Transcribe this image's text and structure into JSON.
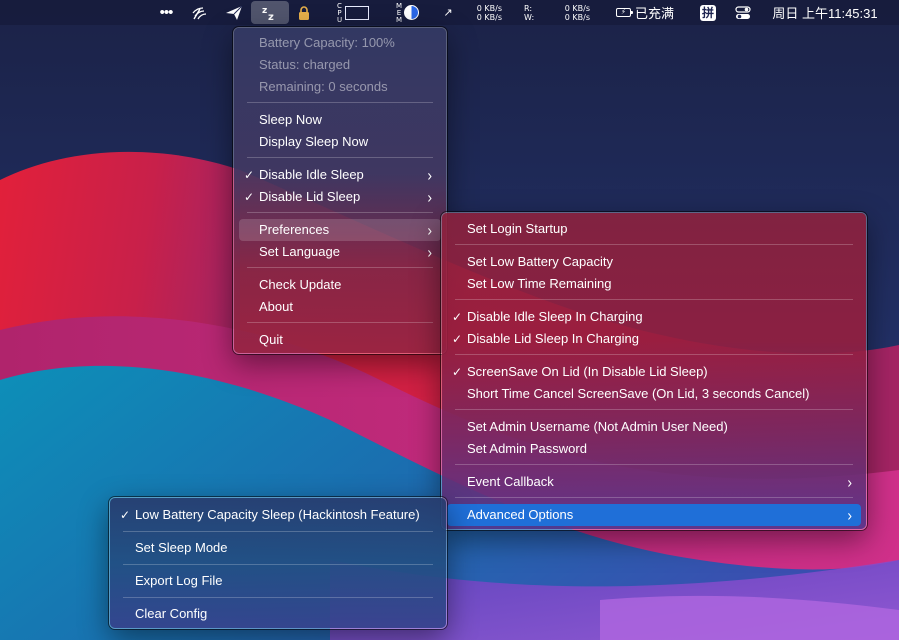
{
  "menubar": {
    "net_upload": "0 KB/s",
    "net_download": "0 KB/s",
    "disk_read_label": "R:",
    "disk_write_label": "W:",
    "disk_read": "0 KB/s",
    "disk_write": "0 KB/s",
    "cpu_label": "CPU",
    "mem_label": "MEM",
    "battery_status": "已充满",
    "input_method": "拼",
    "clock": "周日 上午11:45:31",
    "icons": [
      "more-icon",
      "network-icon",
      "paper-plane-icon",
      "sleep-zz-icon",
      "lock-icon",
      "cpu-graph-icon",
      "memory-pie-icon",
      "fan-icon",
      "battery-icon",
      "input-method-icon",
      "control-center-icon"
    ]
  },
  "main_menu": {
    "info": [
      "Battery Capacity: 100%",
      "Status: charged",
      "Remaining: 0 seconds"
    ],
    "sleep_now": "Sleep Now",
    "display_sleep_now": "Display Sleep Now",
    "disable_idle_sleep": "Disable Idle Sleep",
    "disable_lid_sleep": "Disable Lid Sleep",
    "preferences": "Preferences",
    "set_language": "Set Language",
    "check_update": "Check Update",
    "about": "About",
    "quit": "Quit"
  },
  "preferences_menu": {
    "set_login_startup": "Set Login Startup",
    "set_low_battery_capacity": "Set Low Battery Capacity",
    "set_low_time_remaining": "Set Low Time Remaining",
    "disable_idle_sleep_charging": "Disable Idle Sleep In Charging",
    "disable_lid_sleep_charging": "Disable Lid Sleep In Charging",
    "screensave_on_lid": "ScreenSave On Lid (In Disable Lid Sleep)",
    "short_time_cancel": "Short Time Cancel ScreenSave (On Lid, 3 seconds Cancel)",
    "set_admin_username": "Set Admin Username (Not Admin User Need)",
    "set_admin_password": "Set Admin Password",
    "event_callback": "Event Callback",
    "advanced_options": "Advanced Options"
  },
  "advanced_menu": {
    "low_battery_sleep": "Low Battery Capacity Sleep (Hackintosh Feature)",
    "set_sleep_mode": "Set Sleep Mode",
    "export_log_file": "Export Log File",
    "clear_config": "Clear Config"
  },
  "glyphs": {
    "check": "✓",
    "arrow": "›"
  },
  "colors": {
    "selection": "#1f6fd8",
    "accent_blue": "#2a67e8"
  }
}
